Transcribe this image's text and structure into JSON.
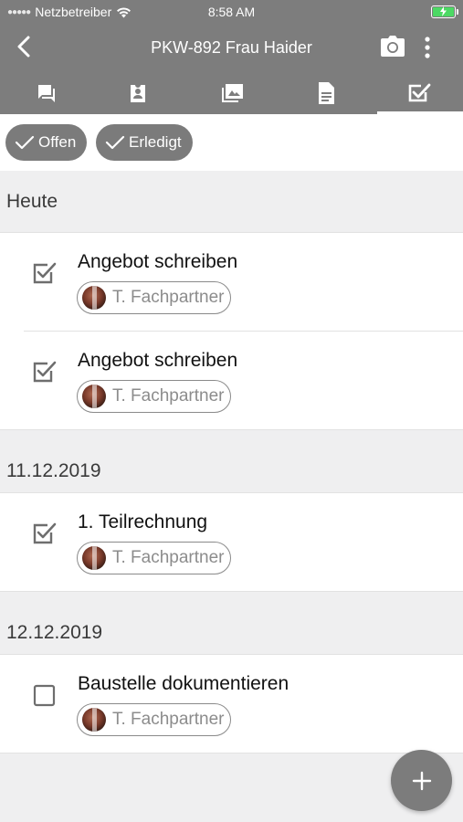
{
  "status_bar": {
    "carrier": "Netzbetreiber",
    "time": "8:58 AM"
  },
  "nav": {
    "title": "PKW-892  Frau Haider",
    "icons": [
      "back-arrow-icon",
      "camera-icon",
      "more-vertical-icon"
    ]
  },
  "tabs": [
    {
      "icon": "chat-icon"
    },
    {
      "icon": "contact-badge-icon"
    },
    {
      "icon": "photos-icon"
    },
    {
      "icon": "document-icon"
    },
    {
      "icon": "checklist-icon",
      "active": true
    }
  ],
  "filters": {
    "open_label": "Offen",
    "done_label": "Erledigt"
  },
  "sections": [
    {
      "heading": "Heute",
      "tasks": [
        {
          "title": "Angebot schreiben",
          "assignee": "T. Fachpartner",
          "checked": true
        },
        {
          "title": "Angebot schreiben",
          "assignee": "T. Fachpartner",
          "checked": true
        }
      ]
    },
    {
      "heading": "11.12.2019",
      "tasks": [
        {
          "title": "1. Teilrechnung",
          "assignee": "T. Fachpartner",
          "checked": true
        }
      ]
    },
    {
      "heading": "12.12.2019",
      "tasks": [
        {
          "title": "Baustelle dokumentieren",
          "assignee": "T. Fachpartner",
          "checked": false
        }
      ]
    }
  ],
  "fab": {
    "icon": "plus-icon",
    "label": "+"
  },
  "colors": {
    "header": "#7d7d7d",
    "chip": "#7b7b7b",
    "check": "#6e6e6e",
    "battery": "#4cd964",
    "background": "#efeff0"
  }
}
